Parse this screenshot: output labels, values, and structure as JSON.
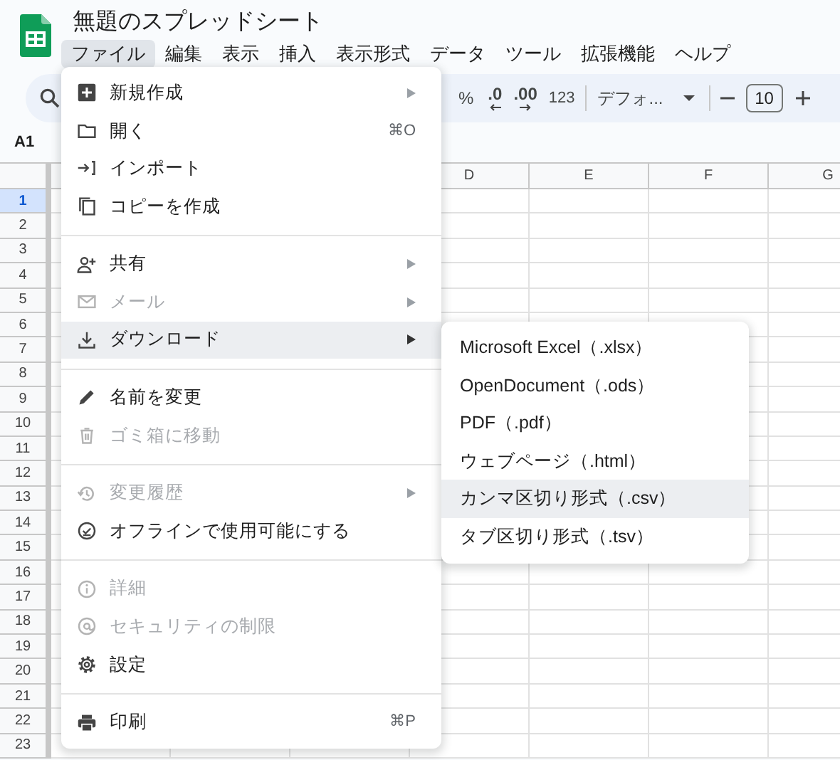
{
  "document_title": "無題のスプレッドシート",
  "menu_bar": [
    {
      "label": "ファイル",
      "selected": true
    },
    {
      "label": "編集",
      "selected": false
    },
    {
      "label": "表示",
      "selected": false
    },
    {
      "label": "挿入",
      "selected": false
    },
    {
      "label": "表示形式",
      "selected": false
    },
    {
      "label": "データ",
      "selected": false
    },
    {
      "label": "ツール",
      "selected": false
    },
    {
      "label": "拡張機能",
      "selected": false
    },
    {
      "label": "ヘルプ",
      "selected": false
    }
  ],
  "toolbar": {
    "percent": "%",
    "decrease_decimal": ".0",
    "increase_decimal": ".00",
    "number_format": "123",
    "font": "デフォ...",
    "font_size": "10"
  },
  "name_box": "A1",
  "grid": {
    "columns": [
      "D",
      "E",
      "F",
      "G"
    ],
    "rows": [
      {
        "label": "1",
        "selected": true
      },
      {
        "label": "2",
        "selected": false
      },
      {
        "label": "3",
        "selected": false
      },
      {
        "label": "4",
        "selected": false
      },
      {
        "label": "5",
        "selected": false
      },
      {
        "label": "6",
        "selected": false
      },
      {
        "label": "7",
        "selected": false
      },
      {
        "label": "8",
        "selected": false
      },
      {
        "label": "9",
        "selected": false
      },
      {
        "label": "10",
        "selected": false
      },
      {
        "label": "11",
        "selected": false
      },
      {
        "label": "12",
        "selected": false
      },
      {
        "label": "13",
        "selected": false
      },
      {
        "label": "14",
        "selected": false
      },
      {
        "label": "15",
        "selected": false
      },
      {
        "label": "16",
        "selected": false
      },
      {
        "label": "17",
        "selected": false
      },
      {
        "label": "18",
        "selected": false
      },
      {
        "label": "19",
        "selected": false
      },
      {
        "label": "20",
        "selected": false
      },
      {
        "label": "21",
        "selected": false
      },
      {
        "label": "22",
        "selected": false
      },
      {
        "label": "23",
        "selected": false
      }
    ]
  },
  "file_menu": [
    [
      {
        "label": "新規作成",
        "submenu": true,
        "disabled": false,
        "selected": false
      },
      {
        "label": "開く",
        "shortcut": "⌘O",
        "disabled": false,
        "selected": false
      },
      {
        "label": "インポート",
        "disabled": false,
        "selected": false
      },
      {
        "label": "コピーを作成",
        "disabled": false,
        "selected": false
      }
    ],
    [
      {
        "label": "共有",
        "submenu": true,
        "disabled": false,
        "selected": false
      },
      {
        "label": "メール",
        "submenu": true,
        "disabled": true,
        "selected": false
      },
      {
        "label": "ダウンロード",
        "submenu": true,
        "disabled": false,
        "selected": true
      }
    ],
    [
      {
        "label": "名前を変更",
        "disabled": false,
        "selected": false
      },
      {
        "label": "ゴミ箱に移動",
        "disabled": true,
        "selected": false
      }
    ],
    [
      {
        "label": "変更履歴",
        "submenu": true,
        "disabled": true,
        "selected": false
      },
      {
        "label": "オフラインで使用可能にする",
        "disabled": false,
        "selected": false
      }
    ],
    [
      {
        "label": "詳細",
        "disabled": true,
        "selected": false
      },
      {
        "label": "セキュリティの制限",
        "disabled": true,
        "selected": false
      },
      {
        "label": "設定",
        "disabled": false,
        "selected": false
      }
    ],
    [
      {
        "label": "印刷",
        "shortcut": "⌘P",
        "disabled": false,
        "selected": false
      }
    ]
  ],
  "download_submenu": [
    {
      "label": "Microsoft Excel（.xlsx）",
      "selected": false
    },
    {
      "label": "OpenDocument（.ods）",
      "selected": false
    },
    {
      "label": "PDF（.pdf）",
      "selected": false
    },
    {
      "label": "ウェブページ（.html）",
      "selected": false
    },
    {
      "label": "カンマ区切り形式（.csv）",
      "selected": true
    },
    {
      "label": "タブ区切り形式（.tsv）",
      "selected": false
    }
  ]
}
